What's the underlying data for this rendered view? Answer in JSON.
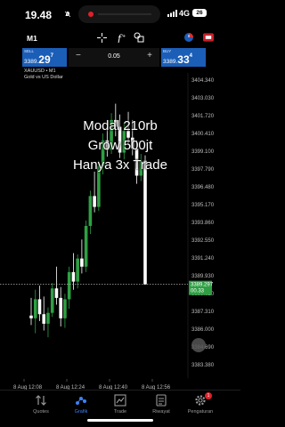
{
  "status_bar": {
    "time": "19.48",
    "network": "4G",
    "battery": "26"
  },
  "toolbar": {
    "timeframe": "M1"
  },
  "trade": {
    "sell_label": "SELL",
    "sell_price_prefix": "3389.",
    "sell_price_big": "29",
    "sell_price_sup": "7",
    "buy_label": "BUY",
    "buy_price_prefix": "3389.",
    "buy_price_big": "33",
    "buy_price_sup": "4",
    "lot_minus": "−",
    "lot_value": "0.05",
    "lot_plus": "+"
  },
  "chart": {
    "symbol": "XAUUSD • M1",
    "description": "Gold vs US Dollar",
    "y_labels": [
      "3404.340",
      "3403.030",
      "3401.720",
      "3400.410",
      "3399.100",
      "3397.790",
      "3396.480",
      "3395.170",
      "3393.860",
      "3392.550",
      "3391.240",
      "3389.930",
      "3388.620",
      "3387.310",
      "3386.000",
      "3384.690",
      "3383.380"
    ],
    "x_labels": [
      "8 Aug 12:08",
      "8 Aug 12:24",
      "8 Aug 12:40",
      "8 Aug 12:56"
    ],
    "current_bid": "3389.297",
    "current_ask": "00.33",
    "colors": {
      "up": "#2ea043",
      "down": "#ffffff",
      "bid_box": "#2ea043",
      "price_line": "#cfcfcf"
    }
  },
  "chart_data": {
    "type": "candlestick",
    "title": "",
    "ylim": [
      3383.38,
      3404.34
    ],
    "x_ticks": [
      "8 Aug 12:08",
      "8 Aug 12:24",
      "8 Aug 12:40",
      "8 Aug 12:56"
    ],
    "candles": [
      {
        "o": 3387.0,
        "h": 3388.3,
        "l": 3386.3,
        "c": 3386.8
      },
      {
        "o": 3386.8,
        "h": 3388.9,
        "l": 3385.7,
        "c": 3388.2
      },
      {
        "o": 3388.2,
        "h": 3389.2,
        "l": 3386.6,
        "c": 3387.1
      },
      {
        "o": 3387.1,
        "h": 3388.4,
        "l": 3385.9,
        "c": 3386.4
      },
      {
        "o": 3386.4,
        "h": 3387.6,
        "l": 3385.4,
        "c": 3387.2
      },
      {
        "o": 3387.2,
        "h": 3389.4,
        "l": 3386.9,
        "c": 3389.0
      },
      {
        "o": 3389.0,
        "h": 3390.6,
        "l": 3387.8,
        "c": 3388.3
      },
      {
        "o": 3388.3,
        "h": 3389.1,
        "l": 3386.2,
        "c": 3386.8
      },
      {
        "o": 3386.8,
        "h": 3388.6,
        "l": 3386.1,
        "c": 3388.2
      },
      {
        "o": 3388.2,
        "h": 3390.6,
        "l": 3387.5,
        "c": 3390.2
      },
      {
        "o": 3390.2,
        "h": 3391.6,
        "l": 3388.9,
        "c": 3389.5
      },
      {
        "o": 3389.5,
        "h": 3391.5,
        "l": 3389.0,
        "c": 3391.2
      },
      {
        "o": 3391.2,
        "h": 3392.6,
        "l": 3390.1,
        "c": 3390.6
      },
      {
        "o": 3390.6,
        "h": 3394.0,
        "l": 3390.2,
        "c": 3393.6
      },
      {
        "o": 3393.6,
        "h": 3396.2,
        "l": 3393.0,
        "c": 3395.8
      },
      {
        "o": 3395.8,
        "h": 3397.6,
        "l": 3394.6,
        "c": 3395.0
      },
      {
        "o": 3395.0,
        "h": 3398.4,
        "l": 3394.7,
        "c": 3398.0
      },
      {
        "o": 3398.0,
        "h": 3400.4,
        "l": 3397.4,
        "c": 3399.9
      },
      {
        "o": 3399.9,
        "h": 3401.4,
        "l": 3398.7,
        "c": 3399.2
      },
      {
        "o": 3399.2,
        "h": 3401.9,
        "l": 3398.9,
        "c": 3401.4
      },
      {
        "o": 3401.4,
        "h": 3402.6,
        "l": 3400.2,
        "c": 3400.9
      },
      {
        "o": 3400.9,
        "h": 3401.8,
        "l": 3398.6,
        "c": 3399.0
      },
      {
        "o": 3399.0,
        "h": 3401.2,
        "l": 3398.5,
        "c": 3400.6
      },
      {
        "o": 3400.6,
        "h": 3402.0,
        "l": 3399.6,
        "c": 3400.1
      },
      {
        "o": 3400.1,
        "h": 3401.4,
        "l": 3398.8,
        "c": 3399.3
      },
      {
        "o": 3399.3,
        "h": 3399.9,
        "l": 3396.7,
        "c": 3397.3
      },
      {
        "o": 3397.3,
        "h": 3398.9,
        "l": 3396.9,
        "c": 3398.4
      },
      {
        "o": 3398.4,
        "h": 3398.8,
        "l": 3389.3,
        "c": 3389.3
      }
    ]
  },
  "caption": {
    "line1": "Modal 210rb",
    "line2": "Grow 500jt",
    "line3": "Hanya 3x Trade"
  },
  "nav": {
    "items": [
      {
        "label": "Quotes",
        "icon": "arrows-updown-icon"
      },
      {
        "label": "Grafik",
        "icon": "chart-nodes-icon"
      },
      {
        "label": "Trade",
        "icon": "trade-chart-icon"
      },
      {
        "label": "Riwayat",
        "icon": "history-icon"
      },
      {
        "label": "Pengaturan",
        "icon": "settings-icon"
      }
    ],
    "badge": "1"
  }
}
